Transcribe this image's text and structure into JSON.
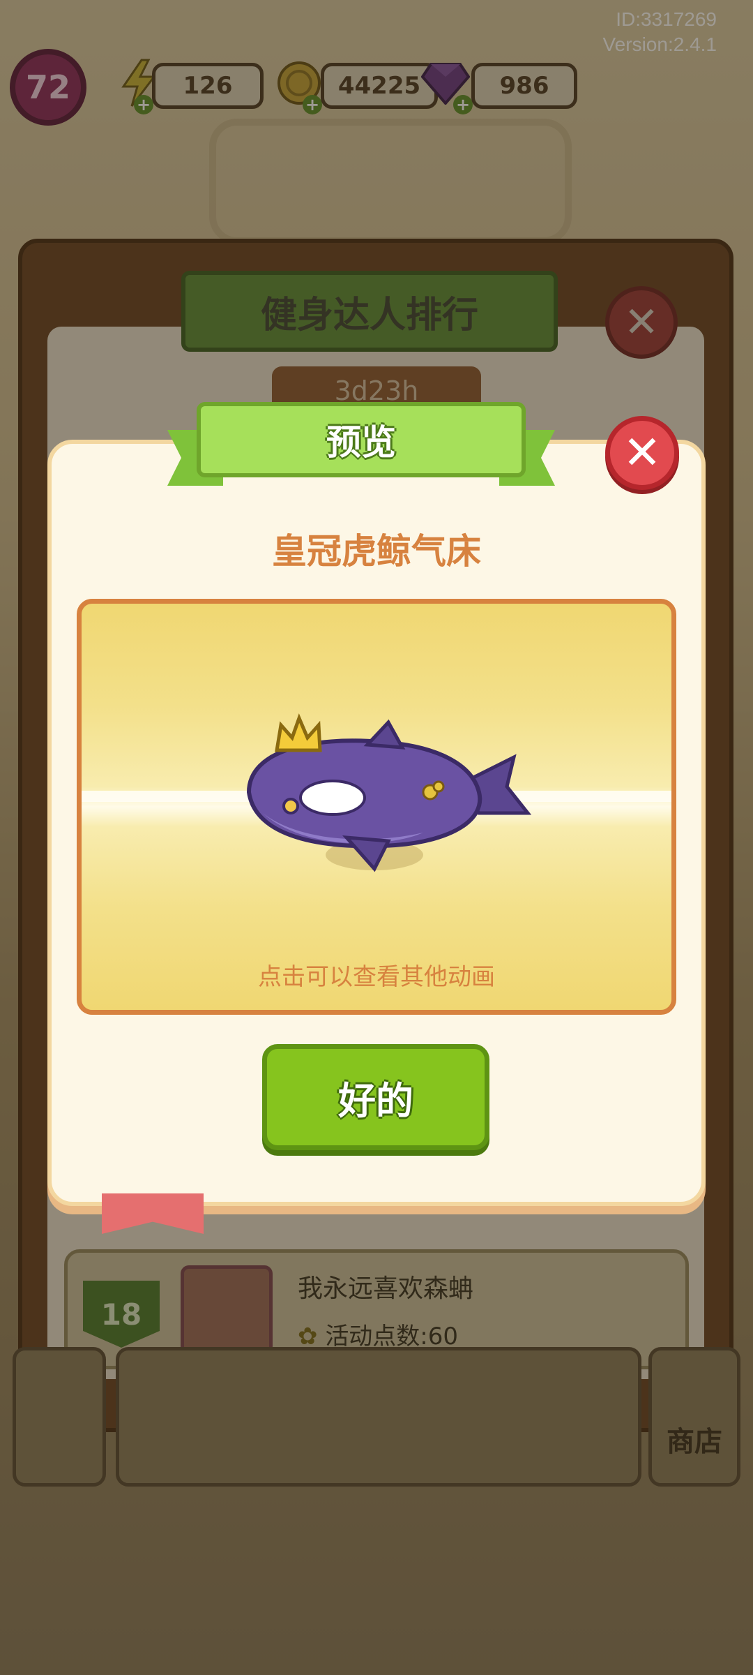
{
  "meta": {
    "id": "ID:3317269",
    "version": "Version:2.4.1"
  },
  "hud": {
    "level": "72",
    "energy": "126",
    "coins": "44225",
    "gems": "986",
    "energy_icon": "lightning-icon",
    "coin_icon": "coin-icon",
    "gem_icon": "gem-icon"
  },
  "board": {
    "title": "健身达人排行",
    "timer": "3d23h",
    "row": {
      "rank": "18",
      "name": "我永远喜欢森蚺",
      "points": "活动点数:60"
    },
    "shop_label": "商店"
  },
  "dialog": {
    "title": "预览",
    "item_name": "皇冠虎鲸气床",
    "hint": "点击可以查看其他动画",
    "ok_label": "好的",
    "close_icon": "close-icon"
  },
  "colors": {
    "accent_green": "#86c41e",
    "title_orange": "#d7823f",
    "close_red": "#e24a4f"
  }
}
